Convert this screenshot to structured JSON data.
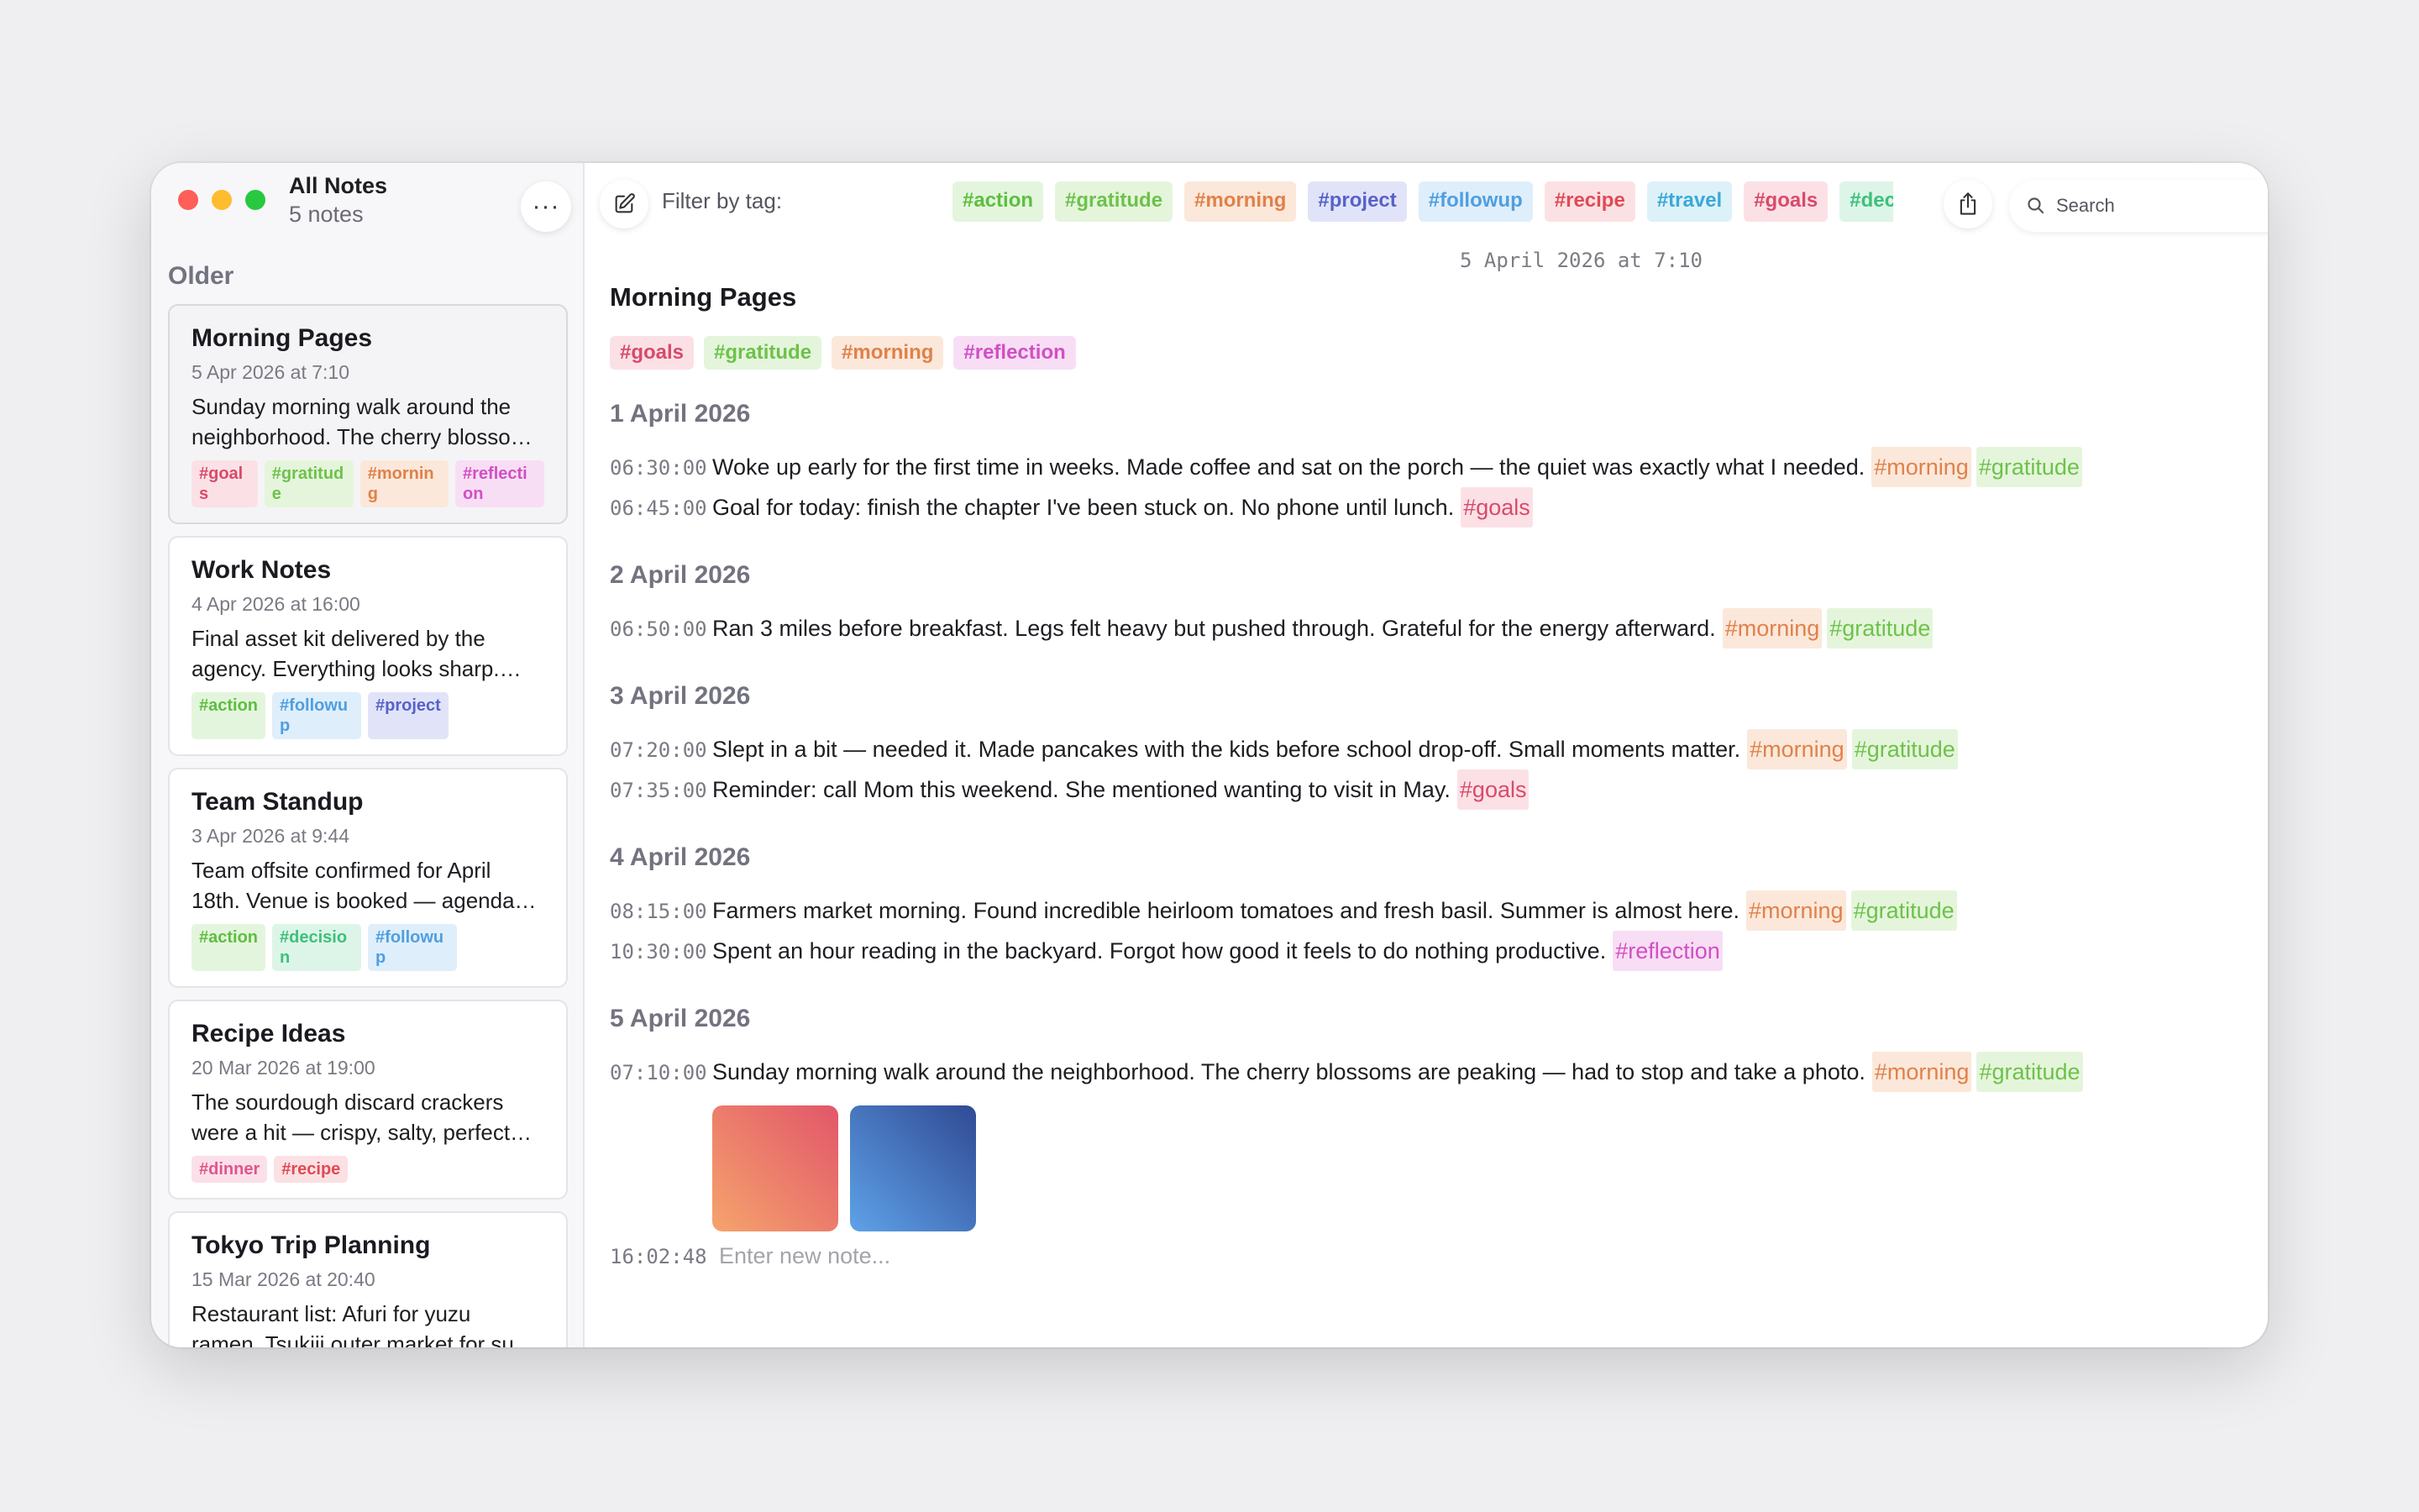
{
  "colors": {
    "tag_goals": {
      "fg": "#d94a6a",
      "bg": "#fbe1e6"
    },
    "tag_gratitude": {
      "fg": "#6dc24a",
      "bg": "#e5f5dc"
    },
    "tag_morning": {
      "fg": "#e0814a",
      "bg": "#fbe8da"
    },
    "tag_reflection": {
      "fg": "#d14fc6",
      "bg": "#f8def4"
    },
    "tag_action": {
      "fg": "#5cbf3f",
      "bg": "#e4f5dd"
    },
    "tag_followup": {
      "fg": "#4f9fe0",
      "bg": "#dfeefb"
    },
    "tag_project": {
      "fg": "#5662c9",
      "bg": "#e1e4f8"
    },
    "tag_decision": {
      "fg": "#3ec07a",
      "bg": "#ddf5e8"
    },
    "tag_dinner": {
      "fg": "#e0558c",
      "bg": "#fbe0ea"
    },
    "tag_recipe": {
      "fg": "#e04a55",
      "bg": "#fbe1e3"
    },
    "tag_travel": {
      "fg": "#3aa9d6",
      "bg": "#ddf1f9"
    }
  },
  "sidebar": {
    "title": "All Notes",
    "count": "5 notes",
    "more_icon": "ellipsis-icon",
    "section": "Older",
    "notes": [
      {
        "title": "Morning Pages",
        "date": "5 Apr 2026 at 7:10",
        "preview": "Sunday morning walk around the neighborhood. The cherry blossoms are peaking — had to stop and take a photo.",
        "tags": [
          "#goals",
          "#gratitude",
          "#morning",
          "#reflection"
        ]
      },
      {
        "title": "Work Notes",
        "date": "4 Apr 2026 at 16:00",
        "preview": "Final asset kit delivered by the agency. Everything looks sharp. Need to review before sign-off.",
        "tags": [
          "#action",
          "#followup",
          "#project"
        ]
      },
      {
        "title": "Team Standup",
        "date": "3 Apr 2026 at 9:44",
        "preview": "Team offsite confirmed for April 18th. Venue is booked — agenda still to be drafted.",
        "tags": [
          "#action",
          "#decision",
          "#followup"
        ]
      },
      {
        "title": "Recipe Ideas",
        "date": "20 Mar 2026 at 19:00",
        "preview": "The sourdough discard crackers were a hit — crispy, salty, perfect with cheese.",
        "tags": [
          "#dinner",
          "#recipe"
        ]
      },
      {
        "title": "Tokyo Trip Planning",
        "date": "15 Mar 2026 at 20:40",
        "preview": "Restaurant list: Afuri for yuzu ramen, Tsukiji outer market for sushi breakfast.",
        "tags": []
      }
    ]
  },
  "toolbar": {
    "compose_icon": "compose-icon",
    "filter_label": "Filter by tag:",
    "filter_tags": [
      "#action",
      "#gratitude",
      "#morning",
      "#project",
      "#followup",
      "#recipe",
      "#travel",
      "#goals",
      "#decision"
    ],
    "share_icon": "share-icon",
    "search_placeholder": "Search",
    "search_icon": "search-icon"
  },
  "note": {
    "stamp": "5 April 2026 at 7:10",
    "title": "Morning Pages",
    "tags": [
      "#goals",
      "#gratitude",
      "#morning",
      "#reflection"
    ],
    "days": [
      {
        "date": "1 April 2026",
        "entries": [
          {
            "time": "06:30:00",
            "text": "Woke up early for the first time in weeks. Made coffee and sat on the porch — the quiet was exactly what I needed.",
            "tags": [
              "#morning",
              "#gratitude"
            ]
          },
          {
            "time": "06:45:00",
            "text": "Goal for today: finish the chapter I've been stuck on. No phone until lunch.",
            "tags": [
              "#goals"
            ]
          }
        ]
      },
      {
        "date": "2 April 2026",
        "entries": [
          {
            "time": "06:50:00",
            "text": "Ran 3 miles before breakfast. Legs felt heavy but pushed through. Grateful for the energy afterward.",
            "tags": [
              "#morning",
              "#gratitude"
            ]
          }
        ]
      },
      {
        "date": "3 April 2026",
        "entries": [
          {
            "time": "07:20:00",
            "text": "Slept in a bit — needed it. Made pancakes with the kids before school drop-off. Small moments matter.",
            "tags": [
              "#morning",
              "#gratitude"
            ]
          },
          {
            "time": "07:35:00",
            "text": "Reminder: call Mom this weekend. She mentioned wanting to visit in May.",
            "tags": [
              "#goals"
            ]
          }
        ]
      },
      {
        "date": "4 April 2026",
        "entries": [
          {
            "time": "08:15:00",
            "text": "Farmers market morning. Found incredible heirloom tomatoes and fresh basil. Summer is almost here.",
            "tags": [
              "#morning",
              "#gratitude"
            ]
          },
          {
            "time": "10:30:00",
            "text": "Spent an hour reading in the backyard. Forgot how good it feels to do nothing productive.",
            "tags": [
              "#reflection"
            ]
          }
        ]
      },
      {
        "date": "5 April 2026",
        "entries": [
          {
            "time": "07:10:00",
            "text": "Sunday morning walk around the neighborhood. The cherry blossoms are peaking — had to stop and take a photo.",
            "tags": [
              "#morning",
              "#gratitude"
            ]
          }
        ],
        "attachments": [
          "photo-thumbnail-warm",
          "photo-thumbnail-cool"
        ]
      }
    ],
    "new_entry_time": "16:02:48",
    "new_entry_placeholder": "Enter new note..."
  }
}
